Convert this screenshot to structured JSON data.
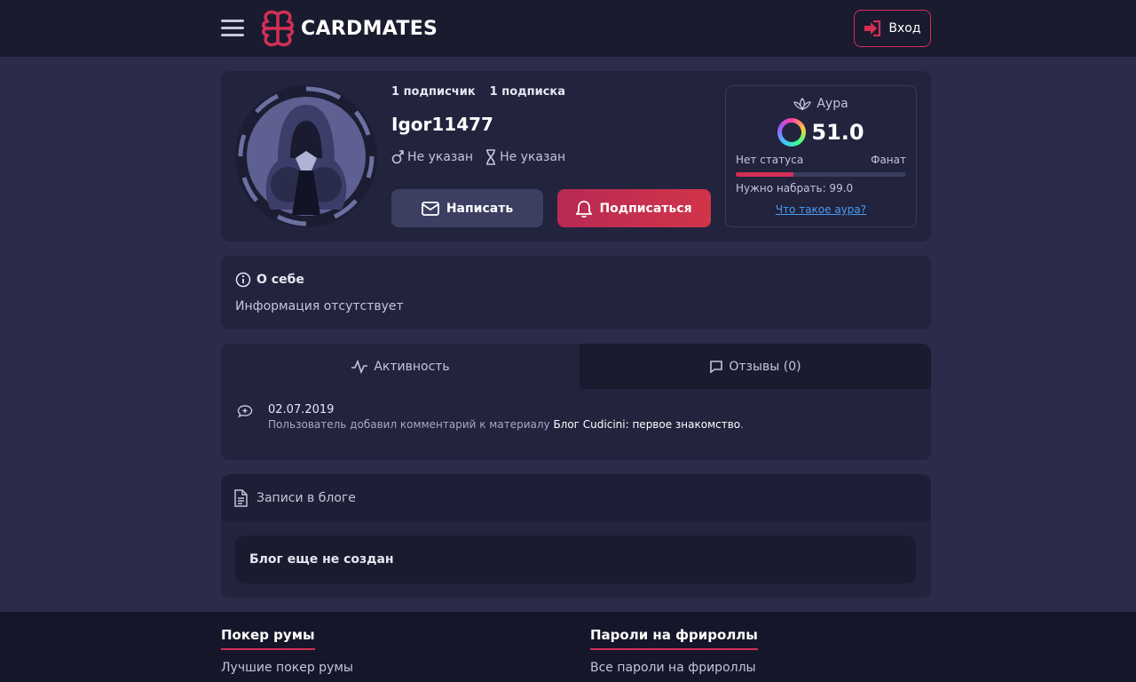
{
  "header": {
    "logo_text": "CARDMATES",
    "login_label": "Вход"
  },
  "profile": {
    "followers": "1 подписчик",
    "following": "1 подписка",
    "username": "Igor11477",
    "gender": "Не указан",
    "age": "Не указан",
    "write_label": "Написать",
    "subscribe_label": "Подписаться"
  },
  "aura": {
    "title": "Аура",
    "value": "51.0",
    "status_current": "Нет статуса",
    "status_next": "Фанат",
    "progress_fraction": 0.34,
    "need": "Нужно набрать: 99.0",
    "link": "Что такое аура?"
  },
  "about": {
    "title": "О себе",
    "text": "Информация отсутствует"
  },
  "tabs": {
    "activity": "Активность",
    "reviews": "Отзывы (0)"
  },
  "activity_item": {
    "date": "02.07.2019",
    "text": "Пользователь добавил комментарий к материалу ",
    "link": "Блог Cudicini: первое знакомство",
    "suffix": "."
  },
  "blog": {
    "title": "Записи в блоге",
    "empty": "Блог еще не создан"
  },
  "footer": {
    "col1_title": "Покер румы",
    "col1_link": "Лучшие покер румы",
    "col2_title": "Пароли на фрироллы",
    "col2_link": "Все пароли на фрироллы"
  },
  "colors": {
    "accent": "#d32f55",
    "background": "#2a2c4a",
    "card": "#22233d",
    "header": "#1a1b2f",
    "link": "#4a9cf0"
  }
}
